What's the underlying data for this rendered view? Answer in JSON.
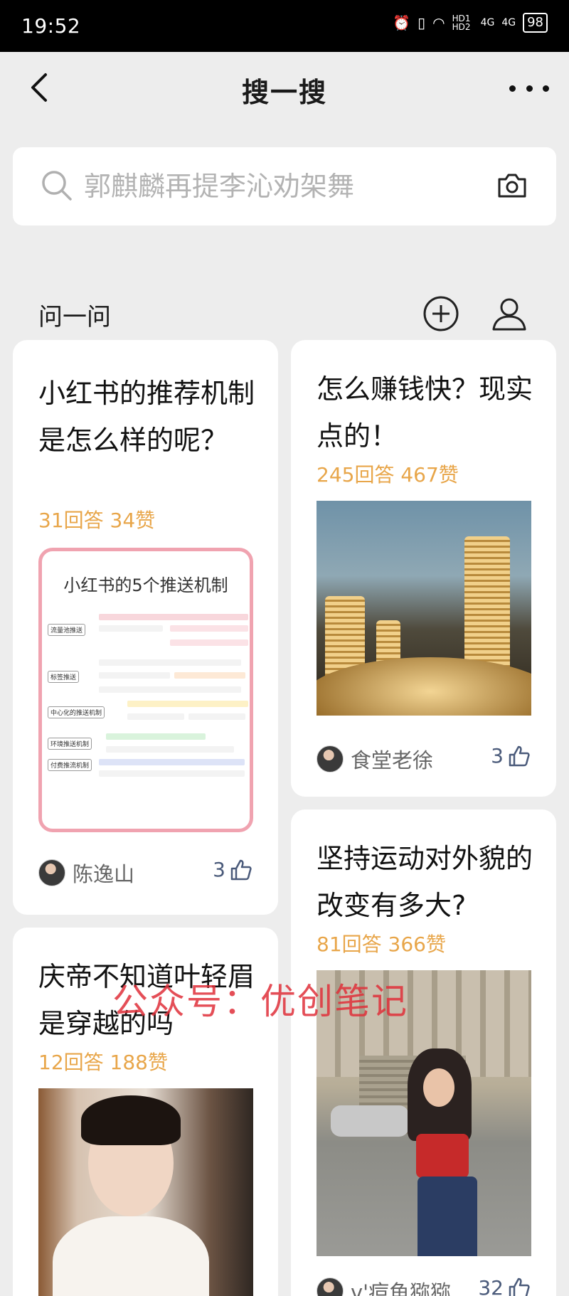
{
  "status_bar": {
    "time": "19:52",
    "network_label": "HD1 HD2",
    "signal_1": "4G",
    "signal_2": "4G",
    "battery": "98"
  },
  "nav": {
    "title": "搜一搜",
    "back_icon": "chevron-left-icon",
    "more_icon": "more-horizontal-icon"
  },
  "search": {
    "placeholder": "郭麒麟再提李沁劝架舞",
    "icon": "search-icon",
    "camera_icon": "camera-icon"
  },
  "section": {
    "title": "问一问",
    "add_icon": "plus-circle-icon",
    "user_icon": "user-icon"
  },
  "cards": [
    {
      "question": "小红书的推荐机制是怎么样的呢？",
      "stats": "31回答 34赞",
      "image_title": "小红书的5个推送机制",
      "mindmap_nodes": [
        "流量池推送",
        "标签推送",
        "中心化的推送机制",
        "环境推送机制",
        "付费推流机制"
      ],
      "author": "陈逸山",
      "likes": "3"
    },
    {
      "question": "怎么赚钱快？现实点的！",
      "stats": "245回答 467赞",
      "author": "食堂老徐",
      "likes": "3"
    },
    {
      "question": "庆帝不知道叶轻眉是穿越的吗",
      "stats": "12回答 188赞"
    },
    {
      "question": "坚持运动对外貌的改变有多大?",
      "stats": "81回答 366赞",
      "author": "v'痘鱼猕猕",
      "likes": "32"
    }
  ],
  "watermark": "公众号：优创笔记",
  "colors": {
    "accent_orange": "#e8a64a",
    "like_blue": "#4a5a7a",
    "background": "#ededed",
    "watermark_red": "#e0303a"
  }
}
